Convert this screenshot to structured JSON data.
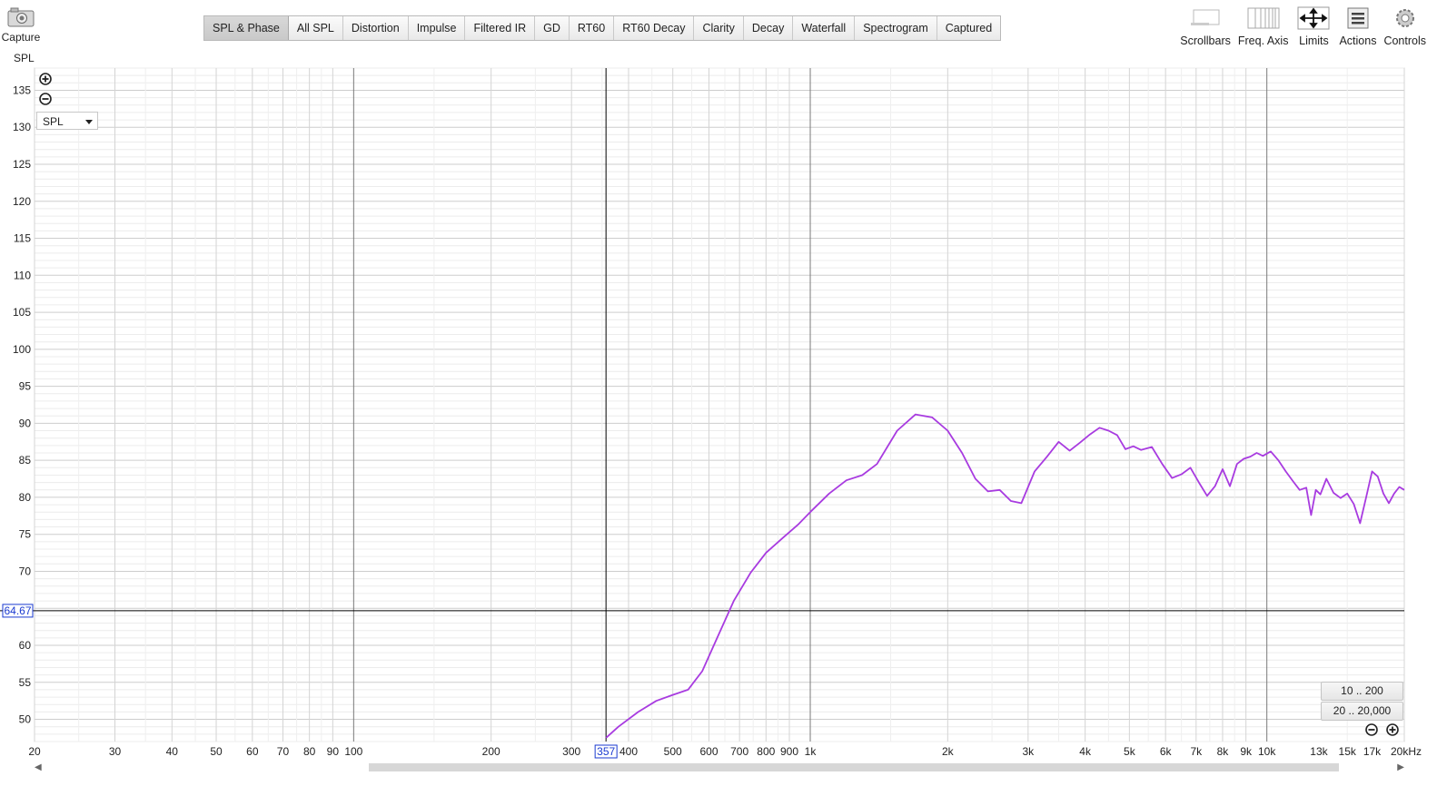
{
  "capture": {
    "label": "Capture",
    "icon": "camera-icon"
  },
  "tabs": [
    {
      "label": "SPL & Phase",
      "active": true
    },
    {
      "label": "All SPL"
    },
    {
      "label": "Distortion"
    },
    {
      "label": "Impulse"
    },
    {
      "label": "Filtered IR"
    },
    {
      "label": "GD"
    },
    {
      "label": "RT60"
    },
    {
      "label": "RT60 Decay"
    },
    {
      "label": "Clarity"
    },
    {
      "label": "Decay"
    },
    {
      "label": "Waterfall"
    },
    {
      "label": "Spectrogram"
    },
    {
      "label": "Captured"
    }
  ],
  "tools": [
    {
      "label": "Scrollbars",
      "icon": "scrollbars-icon"
    },
    {
      "label": "Freq. Axis",
      "icon": "freq-axis-icon"
    },
    {
      "label": "Limits",
      "icon": "limits-icon"
    },
    {
      "label": "Actions",
      "icon": "actions-icon"
    },
    {
      "label": "Controls",
      "icon": "controls-icon"
    }
  ],
  "y_axis_title": "SPL",
  "trace_select": {
    "value": "SPL"
  },
  "range_buttons": [
    "10 .. 200",
    "20 .. 20,000"
  ],
  "cursor": {
    "x_label": "357",
    "y_label": "64.67",
    "x": 357,
    "y": 64.67
  },
  "colors": {
    "trace": "#a83be0",
    "cursor_label": "#1a3ad0"
  },
  "chart_data": {
    "type": "line",
    "title": "",
    "xlabel": "",
    "ylabel": "SPL",
    "x_scale": "log",
    "xlim": [
      20,
      20000
    ],
    "ylim": [
      47,
      138
    ],
    "grid": true,
    "y_ticks": [
      50,
      55,
      60,
      65,
      70,
      75,
      80,
      85,
      90,
      95,
      100,
      105,
      110,
      115,
      120,
      125,
      130,
      135
    ],
    "y_tick_labels": [
      "50",
      "55",
      "60",
      "",
      "70",
      "75",
      "80",
      "85",
      "90",
      "95",
      "100",
      "105",
      "110",
      "115",
      "120",
      "125",
      "130",
      "135"
    ],
    "x_ticks": [
      {
        "v": 20,
        "label": "20"
      },
      {
        "v": 30,
        "label": "30"
      },
      {
        "v": 40,
        "label": "40"
      },
      {
        "v": 50,
        "label": "50"
      },
      {
        "v": 60,
        "label": "60"
      },
      {
        "v": 70,
        "label": "70"
      },
      {
        "v": 80,
        "label": "80"
      },
      {
        "v": 90,
        "label": "90"
      },
      {
        "v": 100,
        "label": "100"
      },
      {
        "v": 200,
        "label": "200"
      },
      {
        "v": 300,
        "label": "300"
      },
      {
        "v": 400,
        "label": "400"
      },
      {
        "v": 500,
        "label": "500"
      },
      {
        "v": 600,
        "label": "600"
      },
      {
        "v": 700,
        "label": "700"
      },
      {
        "v": 800,
        "label": "800"
      },
      {
        "v": 900,
        "label": "900"
      },
      {
        "v": 1000,
        "label": "1k"
      },
      {
        "v": 2000,
        "label": "2k"
      },
      {
        "v": 3000,
        "label": "3k"
      },
      {
        "v": 4000,
        "label": "4k"
      },
      {
        "v": 5000,
        "label": "5k"
      },
      {
        "v": 6000,
        "label": "6k"
      },
      {
        "v": 7000,
        "label": "7k"
      },
      {
        "v": 8000,
        "label": "8k"
      },
      {
        "v": 9000,
        "label": "9k"
      },
      {
        "v": 10000,
        "label": "10k"
      },
      {
        "v": 13000,
        "label": "13k"
      },
      {
        "v": 15000,
        "label": "15k"
      },
      {
        "v": 17000,
        "label": "17k"
      },
      {
        "v": 20000,
        "label": "20kHz"
      }
    ],
    "series": [
      {
        "color": "#a83be0",
        "x": [
          357,
          380,
          420,
          460,
          500,
          540,
          580,
          620,
          680,
          740,
          800,
          870,
          940,
          1000,
          1100,
          1200,
          1300,
          1400,
          1550,
          1700,
          1850,
          2000,
          2150,
          2300,
          2450,
          2600,
          2750,
          2900,
          3100,
          3300,
          3500,
          3700,
          3900,
          4100,
          4300,
          4500,
          4700,
          4900,
          5100,
          5300,
          5600,
          5900,
          6200,
          6500,
          6800,
          7100,
          7400,
          7700,
          8000,
          8300,
          8600,
          8900,
          9200,
          9500,
          9800,
          10200,
          10600,
          11000,
          11400,
          11800,
          12200,
          12500,
          12800,
          13100,
          13500,
          14000,
          14500,
          15000,
          15500,
          16000,
          16500,
          17000,
          17500,
          18000,
          18500,
          19000,
          19500,
          20000
        ],
        "y": [
          47.5,
          49.0,
          51.0,
          52.5,
          53.3,
          54.0,
          56.5,
          60.5,
          66.0,
          69.8,
          72.5,
          74.5,
          76.3,
          78.0,
          80.5,
          82.3,
          83.0,
          84.5,
          89.0,
          91.2,
          90.8,
          89.0,
          86.0,
          82.5,
          80.8,
          81.0,
          79.5,
          79.2,
          83.5,
          85.5,
          87.5,
          86.3,
          87.4,
          88.5,
          89.4,
          89.0,
          88.4,
          86.5,
          86.9,
          86.4,
          86.8,
          84.5,
          82.6,
          83.1,
          84.0,
          82.0,
          80.2,
          81.5,
          83.8,
          81.5,
          84.5,
          85.2,
          85.5,
          86.0,
          85.6,
          86.2,
          85.0,
          83.5,
          82.2,
          81.0,
          81.3,
          77.6,
          81.0,
          80.4,
          82.5,
          80.6,
          79.9,
          80.5,
          79.1,
          76.5,
          80.0,
          83.5,
          82.8,
          80.5,
          79.2,
          80.5,
          81.4,
          81.0
        ]
      }
    ]
  }
}
